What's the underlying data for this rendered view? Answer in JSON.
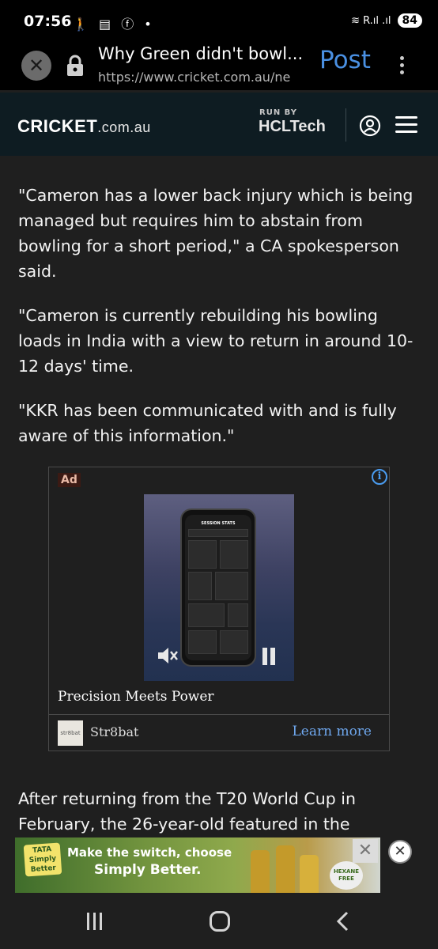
{
  "status_bar": {
    "time": "07:56",
    "left_icons": "🚶 ▤ ⓕ •",
    "signal": "≋ R.ıl .ıl",
    "battery": "84"
  },
  "browser": {
    "page_title": "Why Green didn't bowl...",
    "url": "https://www.cricket.com.au/ne",
    "post_label": "Post"
  },
  "site_header": {
    "logo_main": "CRICKET",
    "logo_domain": ".com.au",
    "run_by": "RUN BY",
    "sponsor": "HCLTech"
  },
  "article": {
    "paragraphs": [
      "\"Cameron has a lower back injury which is being managed but requires him to abstain from bowling for a short period,\" a CA spokesperson said.",
      "\"Cameron is currently rebuilding his bowling loads in India with a view to return in around 10-12 days' time.",
      "\"KKR has been communicated with and is fully aware of this information.\"",
      "After returning from the T20 World Cup in February, the 26-year-old featured in the"
    ]
  },
  "ad_card": {
    "label": "Ad",
    "info": "i",
    "headline": "Precision Meets Power",
    "advertiser": "Str8bat",
    "advertiser_logo_text": "str8bat",
    "cta": "Learn more",
    "phone_screen_title": "SESSION STATS"
  },
  "banner_ad": {
    "brand": "TATA Simply Better",
    "line1": "Make the switch, choose",
    "line2": "Simply Better.",
    "badge": "HEXANE FREE",
    "close": "✕"
  },
  "colors": {
    "background": "#1f1f1f",
    "header_bg": "#0e1c22",
    "post_blue": "#4a90e2",
    "link_blue": "#6fa8ef"
  }
}
